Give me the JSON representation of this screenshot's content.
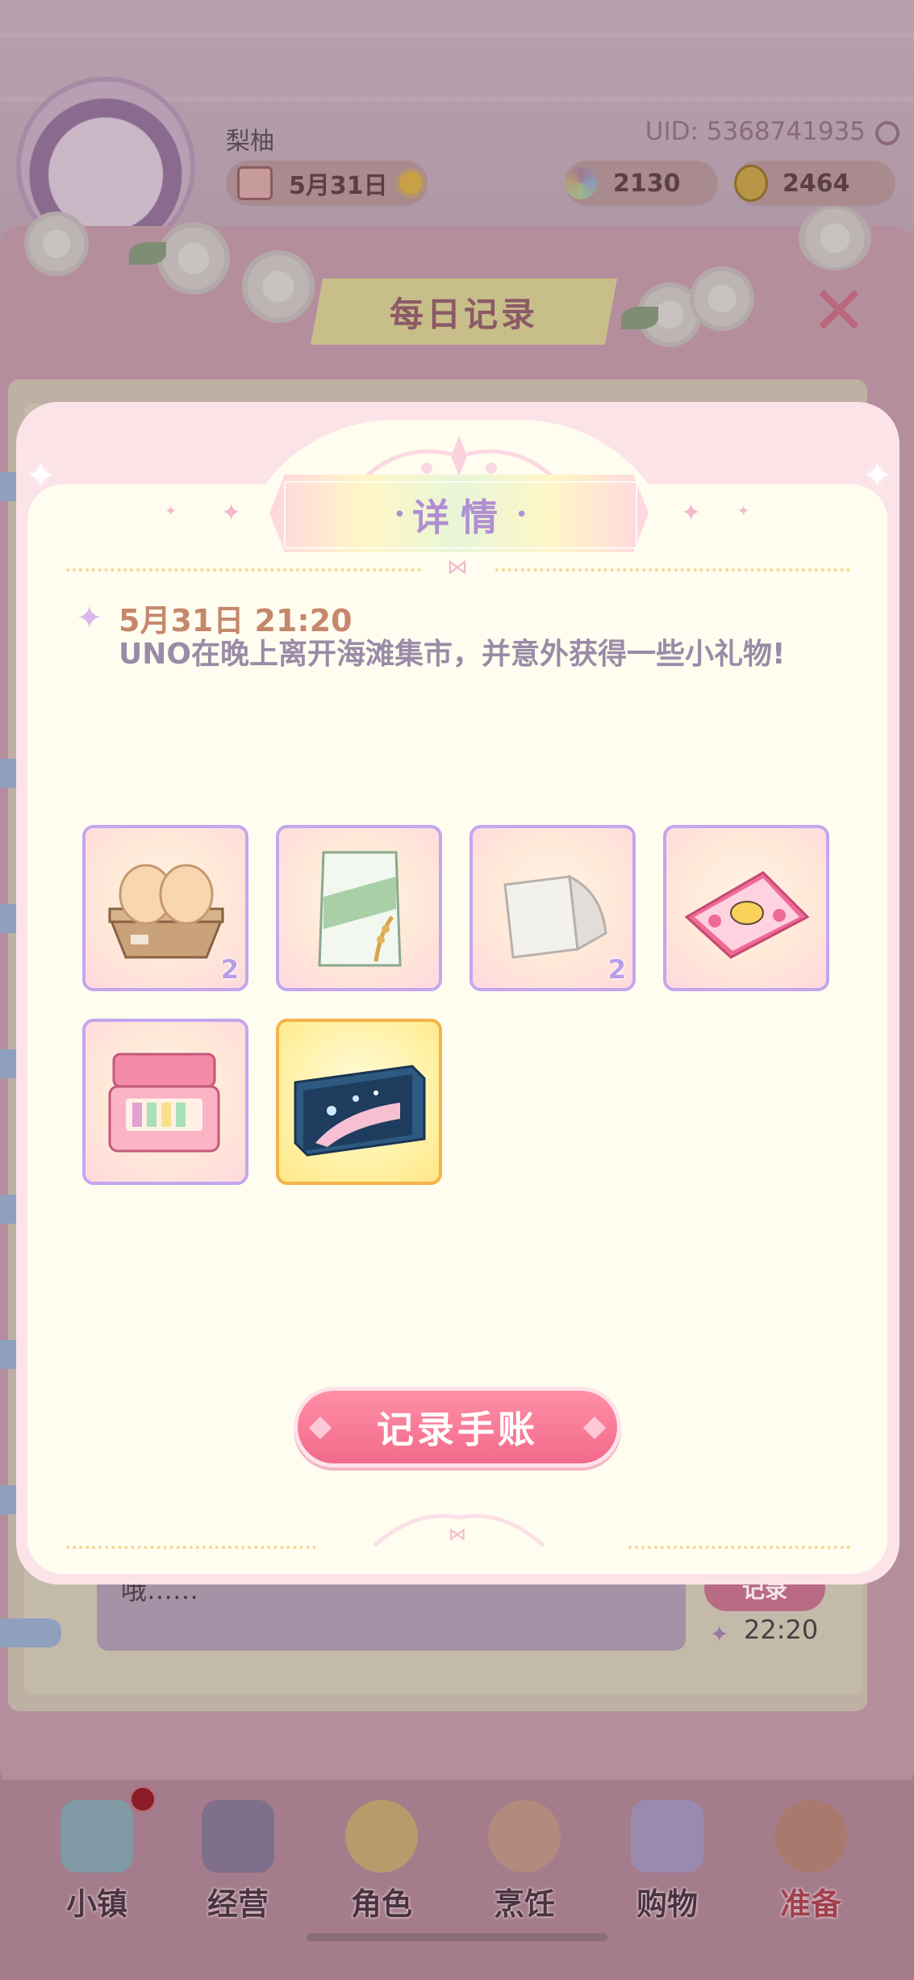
{
  "header": {
    "player_name": "梨柚",
    "uid": "UID: 5368741935",
    "date": "5月31日",
    "gems": "2130",
    "coins": "2464"
  },
  "record_panel": {
    "title": "每日记录",
    "close_label": "✕",
    "partial_entry_text": "哦……",
    "record_button": "记录",
    "entry_time": "22:20"
  },
  "modal": {
    "title_left": "详",
    "title_right": "情",
    "entry_time": "5月31日 21:20",
    "entry_text": "UNO在晚上离开海滩集市，并意外获得一些小礼物!",
    "items": [
      {
        "icon": "egg-carton-icon",
        "qty": "2",
        "rarity": "normal"
      },
      {
        "icon": "flour-bag-icon",
        "qty": "",
        "rarity": "normal"
      },
      {
        "icon": "towel-icon",
        "qty": "2",
        "rarity": "normal"
      },
      {
        "icon": "beach-towel-icon",
        "qty": "",
        "rarity": "normal"
      },
      {
        "icon": "makeup-box-icon",
        "qty": "",
        "rarity": "normal"
      },
      {
        "icon": "ocean-gift-box-icon",
        "qty": "",
        "rarity": "gold"
      }
    ],
    "action_button": "记录手账"
  },
  "bottom_nav": [
    {
      "label": "小镇",
      "icon": "map-icon",
      "active": false,
      "badge": true
    },
    {
      "label": "经营",
      "icon": "shop-bag-icon",
      "active": false,
      "badge": false
    },
    {
      "label": "角色",
      "icon": "character-icon",
      "active": false,
      "badge": false
    },
    {
      "label": "烹饪",
      "icon": "cooking-icon",
      "active": false,
      "badge": false
    },
    {
      "label": "购物",
      "icon": "shopping-bag-icon",
      "active": false,
      "badge": false
    },
    {
      "label": "准备",
      "icon": "prepare-basket-icon",
      "active": true,
      "badge": false
    }
  ],
  "colors": {
    "accent_pink": "#f26a8a",
    "title_purple": "#b18ed2",
    "slot_border": "#c4a6ef",
    "gold_border": "#f5b24a",
    "time_text": "#c4886c"
  }
}
